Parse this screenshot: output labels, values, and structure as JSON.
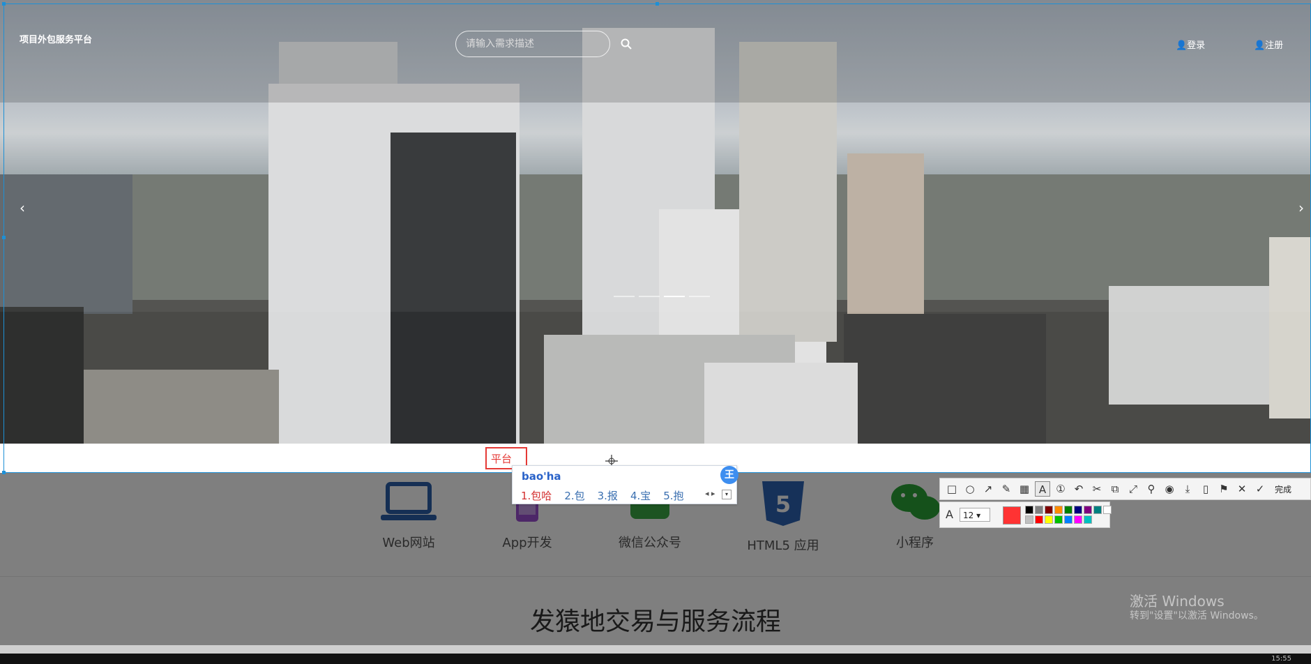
{
  "header": {
    "brand": "项目外包服务平台",
    "search_placeholder": "请输入需求描述",
    "login": "👤登录",
    "register": "👤注册"
  },
  "carousel": {
    "prev": "‹",
    "next": "›",
    "slide_count": 4,
    "active_slide": 3
  },
  "services": [
    {
      "label": "Web网站",
      "icon": "laptop-icon"
    },
    {
      "label": "App开发",
      "icon": "mobile-icon"
    },
    {
      "label": "微信公众号",
      "icon": "wechat-account-icon"
    },
    {
      "label": "HTML5 应用",
      "icon": "html5-icon"
    },
    {
      "label": "小程序",
      "icon": "wechat-icon"
    }
  ],
  "process_title": "发猿地交易与服务流程",
  "annotation": {
    "text": "平台",
    "color": "#e53935"
  },
  "ime": {
    "input": "bao'ha",
    "badge": "王",
    "candidates": [
      "1.包哈",
      "2.包",
      "3.报",
      "4.宝",
      "5.抱"
    ]
  },
  "toolbar": {
    "done_label": "完成",
    "font_size": "12",
    "current_color": "#ff3333",
    "palette": [
      "#000000",
      "#808080",
      "#800000",
      "#ff8c00",
      "#008000",
      "#000080",
      "#800080",
      "#008080",
      "#ffffff",
      "#c0c0c0",
      "#ff0000",
      "#ffff00",
      "#00c000",
      "#0080ff",
      "#ff00ff",
      "#00c0c0"
    ]
  },
  "watermark": {
    "line1": "激活 Windows",
    "line2": "转到\"设置\"以激活 Windows。"
  },
  "taskbar": {
    "clock": "15:55"
  }
}
